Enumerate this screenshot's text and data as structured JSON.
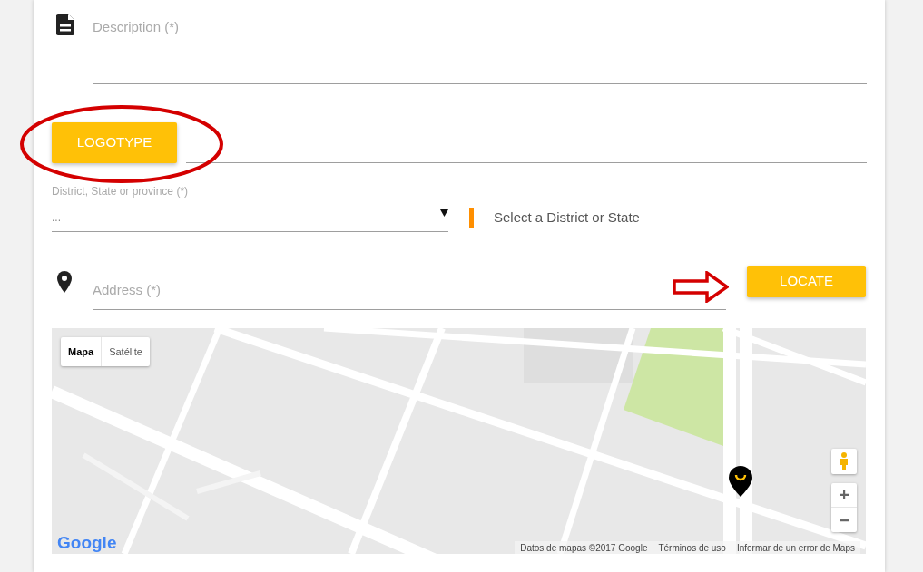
{
  "description_field": {
    "placeholder": "Description (*)"
  },
  "logotype_button": {
    "label": "LOGOTYPE"
  },
  "district_field": {
    "label": "District, State or province (*)",
    "value": "..."
  },
  "district_hint": {
    "text": "Select a District or State"
  },
  "address_field": {
    "placeholder": "Address (*)"
  },
  "locate_button": {
    "label": "LOCATE"
  },
  "map": {
    "kind": "picture",
    "map_types": [
      {
        "label": "Mapa",
        "selected": true
      },
      {
        "label": "Satélite",
        "selected": false
      }
    ],
    "zoom_in": "+",
    "zoom_out": "−",
    "logo": "Google",
    "attribution": [
      "Datos de mapas ©2017 Google",
      "Términos de uso",
      "Informar de un error de Maps"
    ]
  }
}
